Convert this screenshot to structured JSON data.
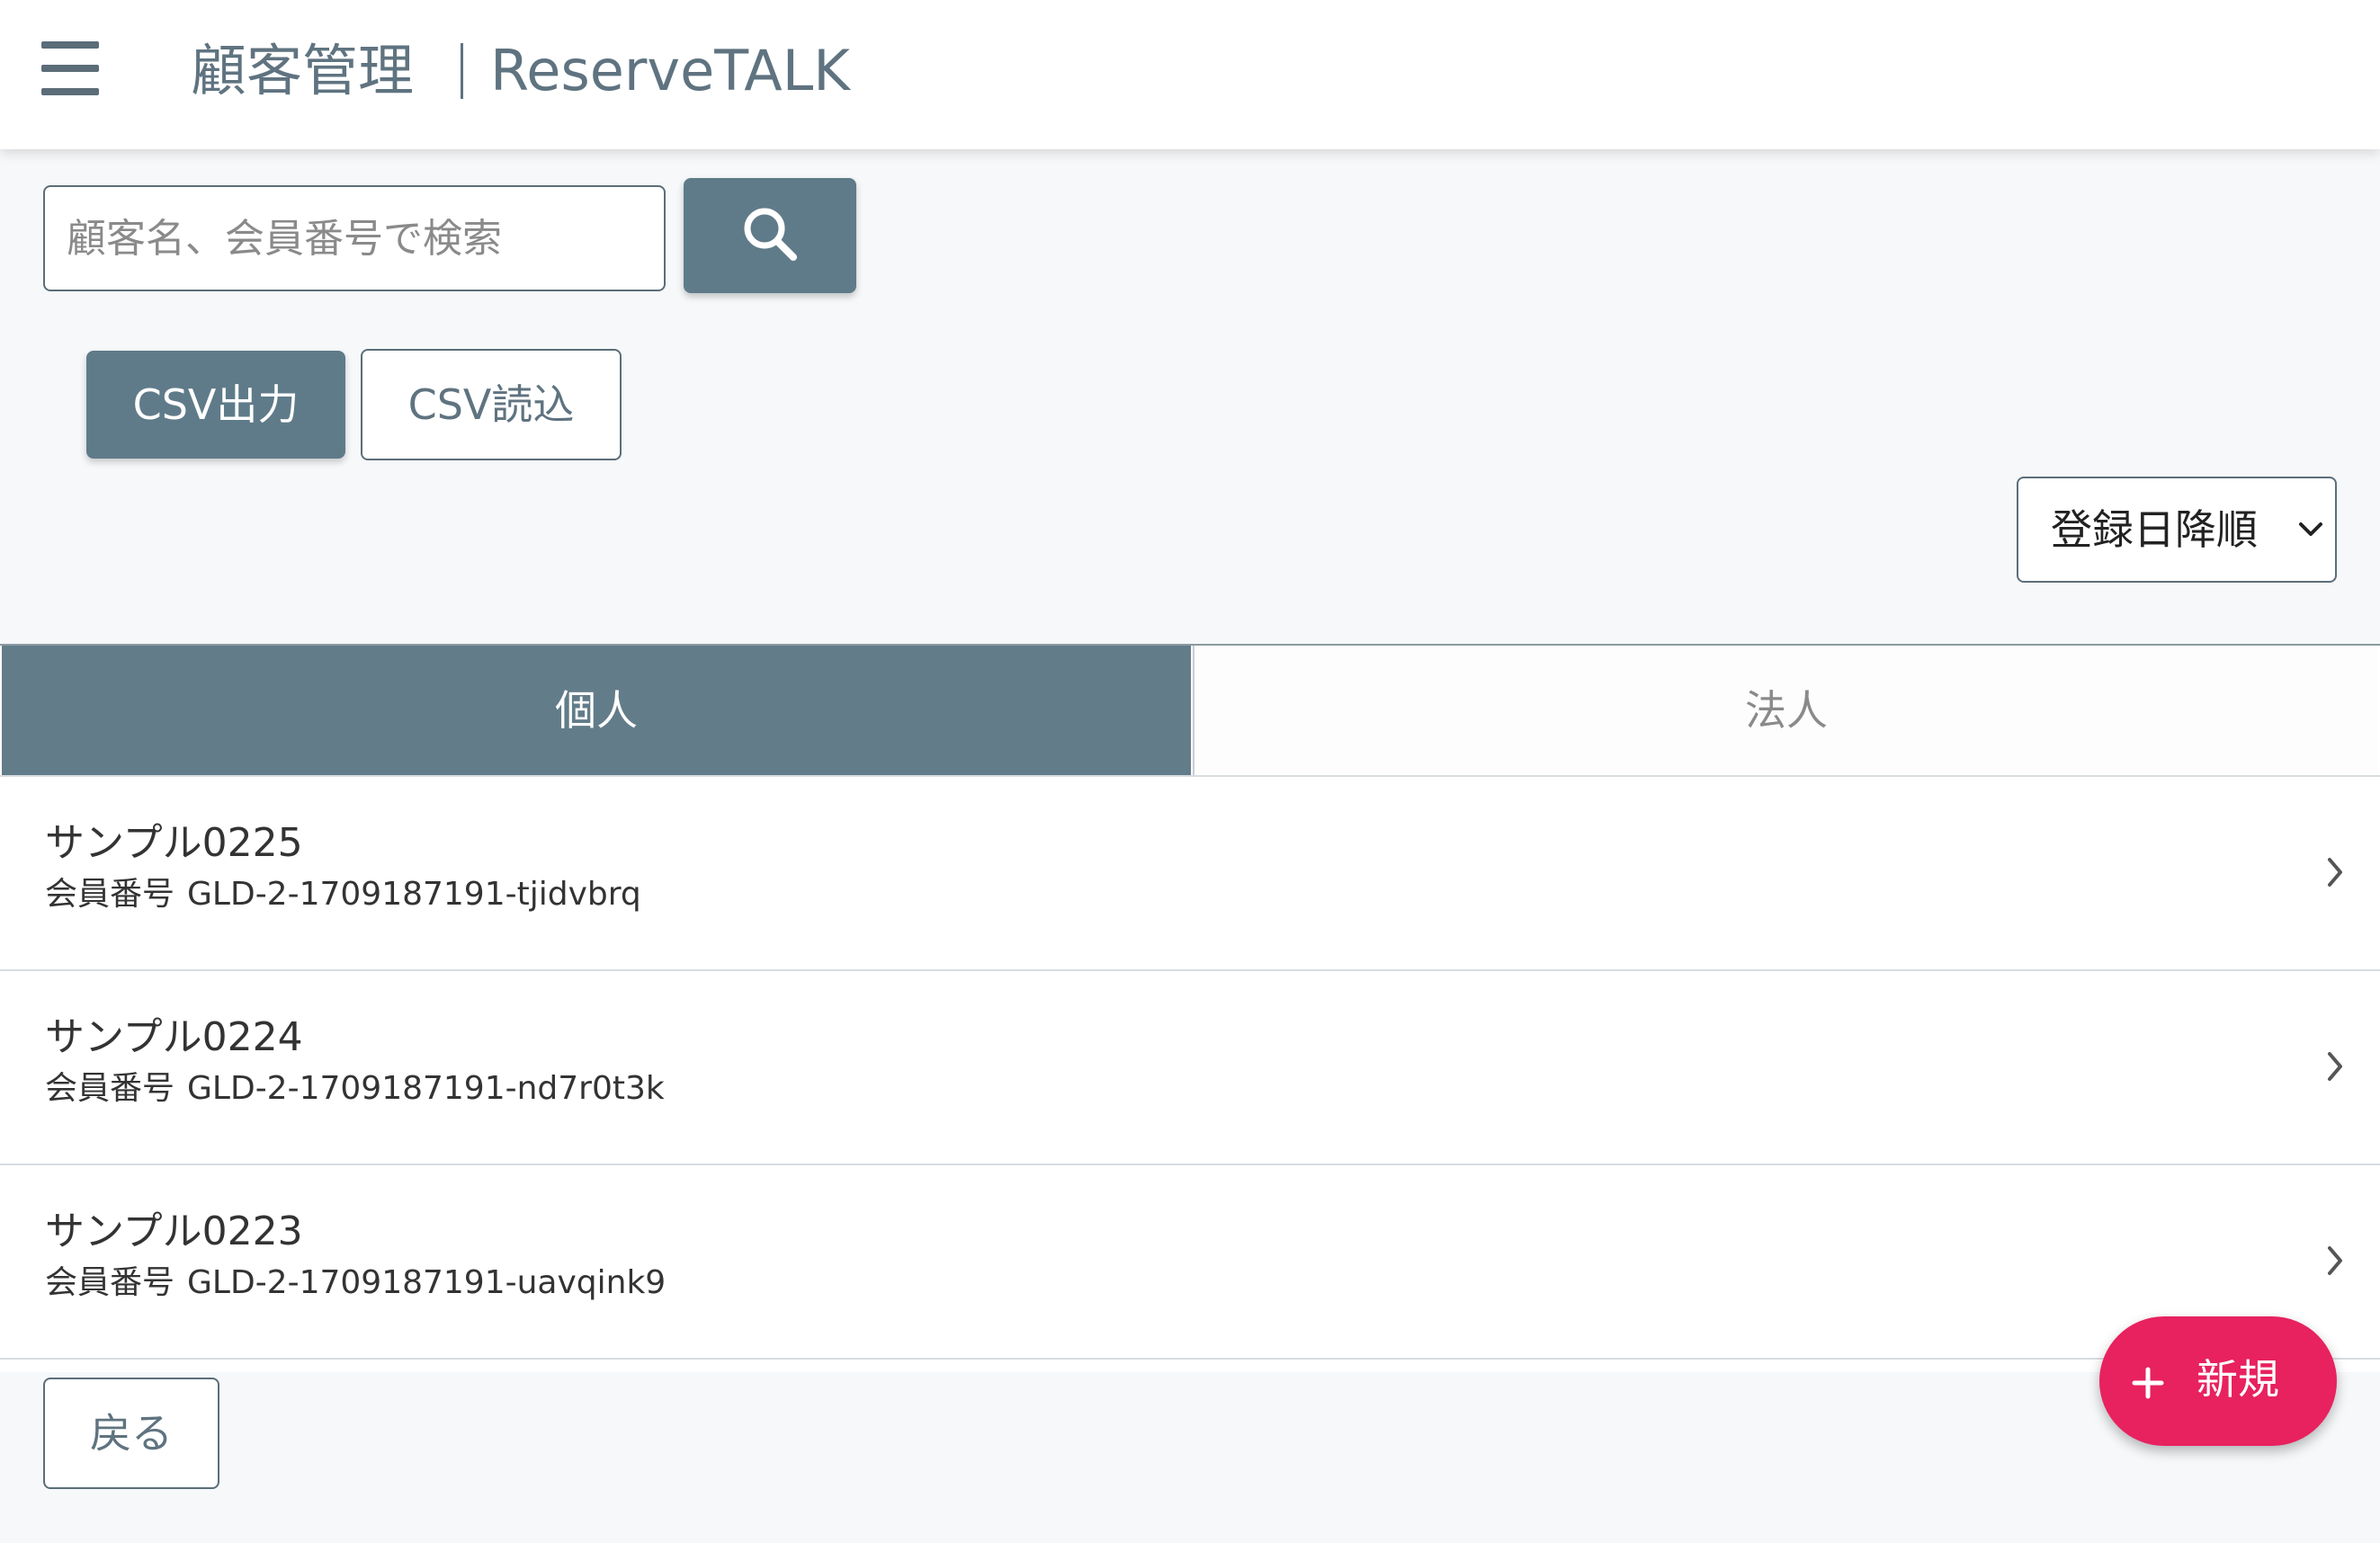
{
  "header": {
    "title": "顧客管理",
    "app_name": "ReserveTALK"
  },
  "search": {
    "placeholder": "顧客名、会員番号で検索",
    "value": ""
  },
  "toolbar": {
    "csv_export_label": "CSV出力",
    "csv_import_label": "CSV読込"
  },
  "sort": {
    "selected": "登録日降順"
  },
  "tabs": [
    {
      "label": "個人",
      "active": true
    },
    {
      "label": "法人",
      "active": false
    }
  ],
  "customers": [
    {
      "name": "サンプル0225",
      "member_label": "会員番号",
      "member_id": "GLD-2-1709187191-tjidvbrq"
    },
    {
      "name": "サンプル0224",
      "member_label": "会員番号",
      "member_id": "GLD-2-1709187191-nd7r0t3k"
    },
    {
      "name": "サンプル0223",
      "member_label": "会員番号",
      "member_id": "GLD-2-1709187191-uavqink9"
    }
  ],
  "footer": {
    "back_label": "戻る",
    "new_label": "新規"
  },
  "colors": {
    "primary": "#5f7b89",
    "accent": "#e8215f",
    "background": "#f6f8fa"
  },
  "icons": {
    "menu": "hamburger-menu-icon",
    "search": "search-icon",
    "sort": "chevron-down-icon",
    "row": "chevron-right-icon",
    "new": "plus-icon"
  }
}
